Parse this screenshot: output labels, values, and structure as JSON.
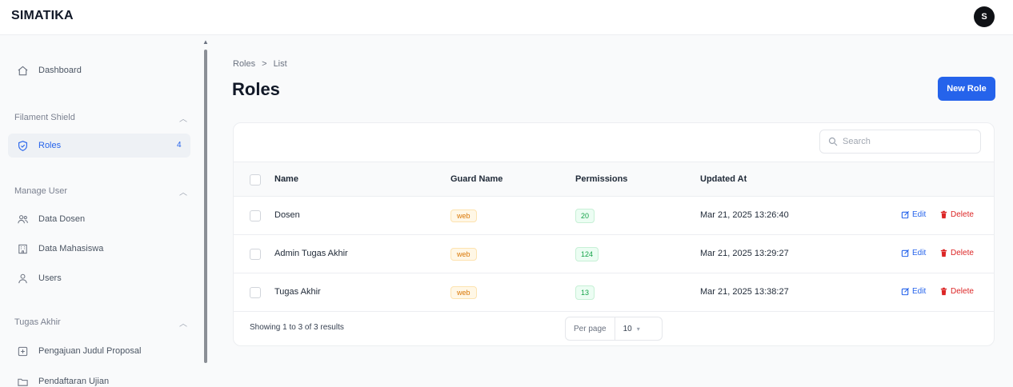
{
  "app": {
    "brand": "SIMATIKA",
    "avatar_initial": "S"
  },
  "sidebar": {
    "dashboard": {
      "label": "Dashboard",
      "icon": "home-icon"
    },
    "groups": [
      {
        "label": "Filament Shield",
        "items": [
          {
            "label": "Roles",
            "icon": "shield-icon",
            "badge": "4",
            "active": true
          }
        ]
      },
      {
        "label": "Manage User",
        "items": [
          {
            "label": "Data Dosen",
            "icon": "users-icon"
          },
          {
            "label": "Data Mahasiswa",
            "icon": "building-icon"
          },
          {
            "label": "Users",
            "icon": "user-icon"
          }
        ]
      },
      {
        "label": "Tugas Akhir",
        "items": [
          {
            "label": "Pengajuan Judul Proposal",
            "icon": "document-add-icon"
          },
          {
            "label": "Pendaftaran Ujian",
            "icon": "folder-icon"
          }
        ]
      }
    ]
  },
  "main": {
    "breadcrumb": [
      "Roles",
      ">",
      "List"
    ],
    "title": "Roles",
    "new_button": "New Role",
    "search": {
      "placeholder": "Search"
    },
    "columns": [
      "Name",
      "Guard Name",
      "Permissions",
      "Updated At"
    ],
    "rows": [
      {
        "name": "Dosen",
        "guard": "web",
        "permissions": "20",
        "updated": "Mar 21, 2025 13:26:40"
      },
      {
        "name": "Admin Tugas Akhir",
        "guard": "web",
        "permissions": "124",
        "updated": "Mar 21, 2025 13:29:27"
      },
      {
        "name": "Tugas Akhir",
        "guard": "web",
        "permissions": "13",
        "updated": "Mar 21, 2025 13:38:27"
      }
    ],
    "actions": {
      "edit": "Edit",
      "delete": "Delete"
    },
    "footer": {
      "showing": "Showing 1 to 3 of 3 results",
      "per_page_label": "Per page",
      "per_page_value": "10"
    }
  },
  "colors": {
    "primary": "#2563eb",
    "danger": "#dc2626",
    "badge_warn": "#d97706",
    "badge_success": "#16a34a"
  }
}
